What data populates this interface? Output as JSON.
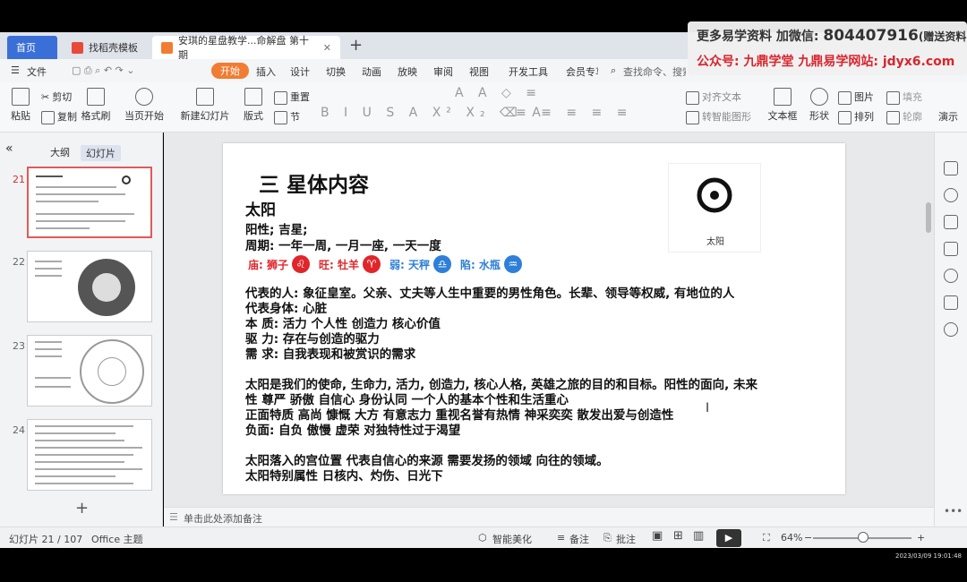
{
  "browser": {
    "tabs": [
      {
        "label": "首页",
        "icon": "home-icon"
      },
      {
        "label": "找稻壳模板",
        "icon": "docer-icon"
      },
      {
        "label": "安琪的星盘教学...命解盘 第十期",
        "icon": "ppt-file-icon"
      }
    ],
    "new_tab": "+"
  },
  "ad": {
    "line1_prefix": "更多易学资料 加微信: ",
    "wechat": "804407916",
    "line1_suffix": "(赠送资料)",
    "line2": "公众号: 九鼎学堂 九鼎易学网站: jdyx6.com"
  },
  "menu": {
    "file": "文件",
    "items": [
      "开始",
      "插入",
      "设计",
      "切换",
      "动画",
      "放映",
      "审阅",
      "视图",
      "开发工具",
      "会员专享"
    ],
    "active": "开始",
    "search_placeholder": "查找命令、搜索"
  },
  "ribbon": {
    "paste": "粘贴",
    "cut": "剪切",
    "copy": "复制",
    "format_painter": "格式刷",
    "from_current": "当页开始",
    "new_slide": "新建幻灯片",
    "layout": "版式",
    "section": "节",
    "reset": "重置",
    "align_text": "对齐文本",
    "smart_graphic": "转智能图形",
    "textbox": "文本框",
    "shape": "形状",
    "picture": "图片",
    "fill": "填充",
    "arrange": "排列",
    "outline": "轮廓",
    "present": "演示"
  },
  "left_panel": {
    "tabs": [
      "大纲",
      "幻灯片"
    ],
    "active_tab": "幻灯片",
    "slide_numbers": [
      "21",
      "22",
      "23",
      "24"
    ],
    "current": "21",
    "add_label": "+"
  },
  "slide": {
    "title": "三 星体内容",
    "subtitle": "太阳",
    "card_label": "太阳",
    "lines": [
      "阳性; 吉星;",
      "周期: 一年一周, 一月一座, 一天一度",
      "代表的人: 象征皇室。父亲、丈夫等人生中重要的男性角色。长辈、领导等权威, 有地位的人",
      "代表身体: 心脏",
      "本   质: 活力 个人性 创造力 核心价值",
      "驱   力: 存在与创造的驱力",
      "需   求: 自我表现和被赏识的需求",
      "太阳是我们的使命, 生命力, 活力, 创造力, 核心人格, 英雄之旅的目的和目标。阳性的面向, 未来",
      "性 尊严 骄傲 自信心 身份认同 一个人的基本个性和生活重心",
      "正面特质 高尚 慷慨 大方 有意志力 重视名誉有热情 神采奕奕 散发出爱与创造性",
      "负面: 自负 傲慢 虚荣 对独特性过于渴望",
      "太阳落入的宫位置 代表自信心的来源 需要发扬的领域 向往的领域。",
      "太阳特别属性 日核内、灼伤、日光下"
    ],
    "signs": [
      {
        "label": "庙: 狮子",
        "glyph": "♌",
        "color": "#e0262b"
      },
      {
        "label": "旺: 牡羊",
        "glyph": "♈",
        "color": "#e0262b"
      },
      {
        "label": "弱: 天秤",
        "glyph": "♎",
        "color": "#2e7fd8"
      },
      {
        "label": "陷: 水瓶",
        "glyph": "♒",
        "color": "#2e7fd8"
      }
    ]
  },
  "notes_placeholder": "单击此处添加备注",
  "status": {
    "slide_count": "幻灯片 21 / 107",
    "theme": "Office 主题",
    "beautify": "智能美化",
    "notes": "备注",
    "comments": "批注",
    "zoom": "64%",
    "zoom_fraction": 0.45,
    "timestamp": "2023/03/09 19:01:48"
  }
}
